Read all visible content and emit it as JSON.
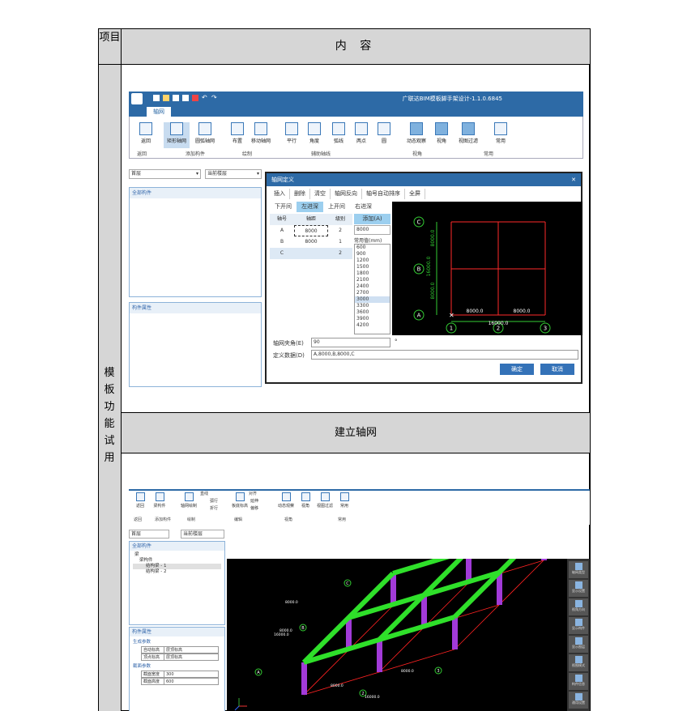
{
  "table": {
    "header_left": "项目",
    "header_right": "内  容",
    "side_label": "模板功能试用",
    "caption": "建立轴网"
  },
  "shot1": {
    "app_title": "广联达BIM模板脚手架设计-1.1.0.6845",
    "active_tab": "轴网",
    "ribbon_items": [
      "返回",
      "矩形轴网",
      "圆弧轴网",
      "布置",
      "移动轴网",
      "平行",
      "角度",
      "弧线",
      "两点",
      "圆",
      "动态观察",
      "视角",
      "视图过滤",
      "常用"
    ],
    "groups": [
      "返回",
      "添加构件",
      "绘制",
      "辅助轴线",
      "视角",
      "常用"
    ],
    "floor_select": "首层",
    "current_floor": "当前楼层",
    "panel_all": "全部构件",
    "panel_props": "构件属性",
    "dialog": {
      "title": "轴网定义",
      "toolbar": [
        "插入",
        "删除",
        "清空",
        "轴网反向",
        "轴号自动排序",
        "全屏"
      ],
      "tabs": [
        "下开间",
        "左进深",
        "上开间",
        "右进深"
      ],
      "headers": [
        "轴号",
        "轴距",
        "级别"
      ],
      "rows": [
        [
          "A",
          "8000",
          "2"
        ],
        [
          "B",
          "8000",
          "1"
        ],
        [
          "C",
          "",
          "2"
        ]
      ],
      "add_label": "添加(A)",
      "add_value": "8000",
      "common_label": "常用值(mm)",
      "common_values": [
        "600",
        "900",
        "1200",
        "1500",
        "1800",
        "2100",
        "2400",
        "2700",
        "3000",
        "3300",
        "3600",
        "3900",
        "4200"
      ],
      "angle_label": "轴网夹角(E)",
      "angle_value": "90",
      "angle_unit": "°",
      "def_label": "定义数据(D)",
      "def_value": "A,8000,B,8000,C",
      "ok": "确定",
      "cancel": "取消",
      "cad_labels": {
        "c": "C",
        "b": "B",
        "a": "A",
        "n1": "1",
        "n2": "2",
        "n3": "3",
        "dimv1": "8000.0",
        "dimv2": "16000.0",
        "dimv3": "8000.0",
        "dimh1": "8000.0",
        "dimh2": "8000.0",
        "dimtot": "16000.0"
      }
    }
  },
  "shot2": {
    "ribbon_items": [
      "返回",
      "梁构件",
      "轴网绘制",
      "直线",
      "弧行",
      "折行",
      "板底标高",
      "对齐",
      "延伸",
      "偏移",
      "动态观察",
      "视角",
      "视图过滤",
      "常用"
    ],
    "groups": [
      "返回",
      "添加构件",
      "绘制",
      "编辑",
      "视角",
      "常用"
    ],
    "floor_select": "首层",
    "current_floor": "当前楼层",
    "panel_all": "全部构件",
    "tree": [
      "梁",
      "梁构件",
      "结构梁 - 1",
      "结构梁 - 2"
    ],
    "panel_props": "构件属性",
    "prop_group1": "生成参数",
    "props1": [
      [
        "自动标高",
        "层顶标高"
      ],
      [
        "顶点标高",
        "层顶标高"
      ]
    ],
    "prop_group2": "截面参数",
    "props2": [
      [
        "截面宽度",
        "300"
      ],
      [
        "截面高度",
        "600"
      ]
    ],
    "right_tools": [
      "轴网类型",
      "显示设置",
      "视角方向",
      "显示构件",
      "显示图层",
      "视图模式",
      "构件信息",
      "通用设置"
    ],
    "dims": {
      "a": "A",
      "b": "B",
      "c": "C",
      "n1": "1",
      "n2": "2",
      "n3": "3",
      "d1": "8000.0",
      "d2": "16000.0",
      "d3": "8000.0",
      "d4": "8000.0",
      "d5": "16000.0",
      "d6": "8000.0"
    }
  },
  "colors": {
    "accent": "#2d6aa6",
    "beam": "#33dd22",
    "column": "#9933cc",
    "grid": "#ff2222",
    "dim": "#33cc33"
  }
}
